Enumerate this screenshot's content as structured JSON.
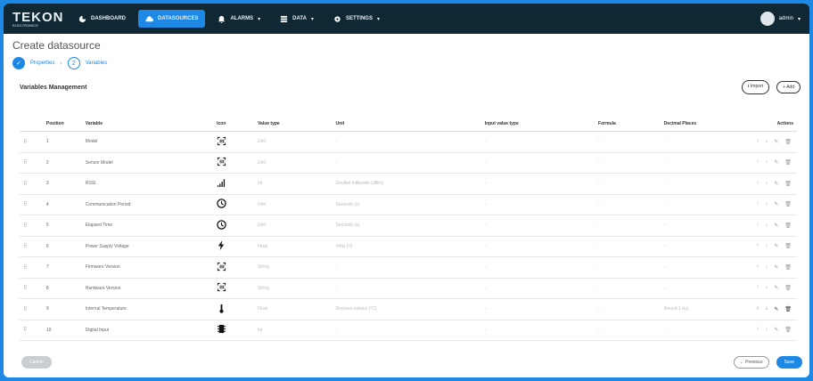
{
  "brand": {
    "name": "TEKON",
    "tagline": "ELECTRONICS"
  },
  "nav": {
    "items": [
      {
        "label": "DASHBOARD",
        "icon": "dashboard-icon"
      },
      {
        "label": "DATASOURCES",
        "icon": "cloud-icon",
        "active": true
      },
      {
        "label": "ALARMS",
        "icon": "bell-icon",
        "caret": "▾"
      },
      {
        "label": "DATA",
        "icon": "database-icon",
        "caret": "▾"
      },
      {
        "label": "SETTINGS",
        "icon": "gear-icon",
        "caret": "▾"
      }
    ],
    "user": {
      "name": "admin",
      "caret": "▾"
    }
  },
  "page": {
    "title": "Create datasource"
  },
  "stepper": {
    "step1": {
      "num": "✓",
      "label": "Properties"
    },
    "step2": {
      "num": "2",
      "label": "Variables"
    }
  },
  "section": {
    "title": "Variables Management",
    "import_label": "⭳ Import",
    "add_label": "+ Add"
  },
  "table": {
    "headers": {
      "position": "Position",
      "variable": "Variable",
      "icon": "Icon",
      "value_type": "Value type",
      "unit": "Unit",
      "input_value_type": "Input value type",
      "formula": "Formula",
      "decimal_places": "Decimal Places",
      "actions": "Actions"
    },
    "rows": [
      {
        "position": "1",
        "variable": "Model",
        "icon": "barcode",
        "value_type": "Uint",
        "unit": "-",
        "input_value_type": "-",
        "formula": "-",
        "decimal_places": "-"
      },
      {
        "position": "2",
        "variable": "Sensor Model",
        "icon": "barcode",
        "value_type": "Uint",
        "unit": "-",
        "input_value_type": "-",
        "formula": "-",
        "decimal_places": "-"
      },
      {
        "position": "3",
        "variable": "RSSI",
        "icon": "signal",
        "value_type": "Int",
        "unit": "Decibel milliwatts (dBm)",
        "input_value_type": "-",
        "formula": "-",
        "decimal_places": "-"
      },
      {
        "position": "4",
        "variable": "Communication Period",
        "icon": "clock",
        "value_type": "Uint",
        "unit": "Seconds (s)",
        "input_value_type": "-",
        "formula": "-",
        "decimal_places": "-"
      },
      {
        "position": "5",
        "variable": "Elapsed Time",
        "icon": "clock",
        "value_type": "Uint",
        "unit": "Seconds (s)",
        "input_value_type": "-",
        "formula": "-",
        "decimal_places": "-"
      },
      {
        "position": "6",
        "variable": "Power Supply Voltage",
        "icon": "bolt",
        "value_type": "Float",
        "unit": "Volts (V)",
        "input_value_type": "-",
        "formula": "-",
        "decimal_places": "-"
      },
      {
        "position": "7",
        "variable": "Firmware Version",
        "icon": "barcode",
        "value_type": "String",
        "unit": "-",
        "input_value_type": "-",
        "formula": "-",
        "decimal_places": "-"
      },
      {
        "position": "8",
        "variable": "Hardware Version",
        "icon": "barcode",
        "value_type": "String",
        "unit": "-",
        "input_value_type": "-",
        "formula": "-",
        "decimal_places": "-"
      },
      {
        "position": "9",
        "variable": "Internal Temperature",
        "icon": "thermometer",
        "value_type": "Float",
        "unit": "Degrees celsius (ºC)",
        "input_value_type": "-",
        "formula": "-",
        "decimal_places": "Round 1 d.p."
      },
      {
        "position": "10",
        "variable": "Digital Input",
        "icon": "chip",
        "value_type": "Int",
        "unit": "-",
        "input_value_type": "-",
        "formula": "-",
        "decimal_places": "-"
      }
    ],
    "drag_glyph": "⠿",
    "action_glyphs": {
      "up": "↑",
      "down": "↓",
      "edit": "✎",
      "delete": "🗑"
    }
  },
  "footer": {
    "cancel_label": "Cancel",
    "previous_label": "← Previous",
    "save_label": "Save"
  }
}
